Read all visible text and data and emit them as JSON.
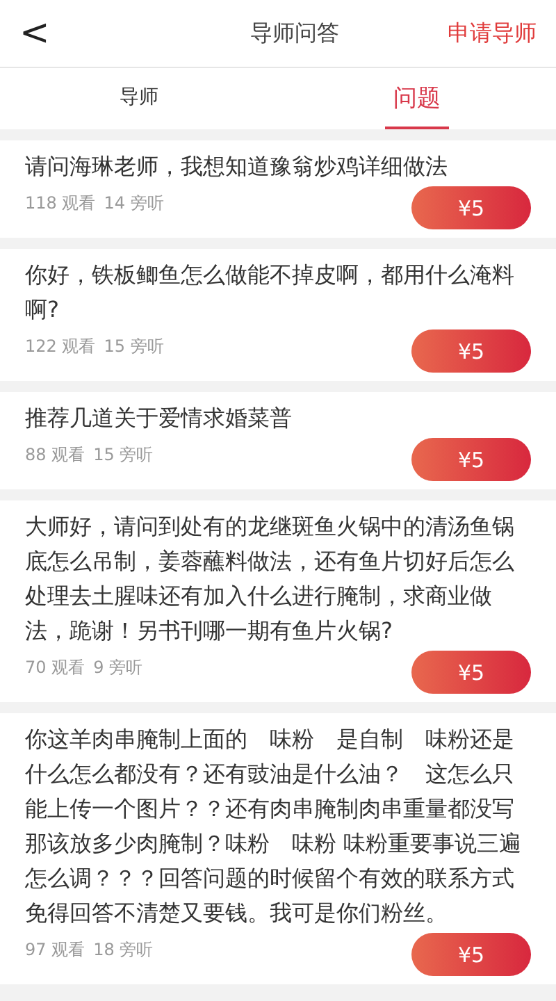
{
  "header": {
    "back": "<",
    "title": "导师问答",
    "action": "申请导师"
  },
  "tabs": [
    {
      "label": "导师",
      "selected": false
    },
    {
      "label": "问题",
      "selected": true
    }
  ],
  "questions": [
    {
      "text": "请问海琳老师，我想知道豫翁炒鸡详细做法",
      "views": "118 观看",
      "listeners": "14 旁听",
      "price": "¥5"
    },
    {
      "text": "你好，铁板鲫鱼怎么做能不掉皮啊，都用什么淹料啊?",
      "views": "122 观看",
      "listeners": "15 旁听",
      "price": "¥5"
    },
    {
      "text": "推荐几道关于爱情求婚菜普",
      "views": "88 观看",
      "listeners": "15 旁听",
      "price": "¥5"
    },
    {
      "text": "大师好，请问到处有的龙继斑鱼火锅中的清汤鱼锅底怎么吊制，姜蓉蘸料做法，还有鱼片切好后怎么处理去土腥味还有加入什么进行腌制，求商业做法，跪谢！另书刊哪一期有鱼片火锅?",
      "views": "70 观看",
      "listeners": "9 旁听",
      "price": "¥5"
    },
    {
      "text": "你这羊肉串腌制上面的　味粉　是自制　味粉还是什么怎么都没有？还有豉油是什么油？　这怎么只能上传一个图片？？还有肉串腌制肉串重量都没写那该放多少肉腌制？味粉　味粉 味粉重要事说三遍怎么调？？？回答问题的时候留个有效的联系方式免得回答不清楚又要钱。我可是你们粉丝。",
      "views": "97 观看",
      "listeners": "18 旁听",
      "price": "¥5"
    }
  ]
}
